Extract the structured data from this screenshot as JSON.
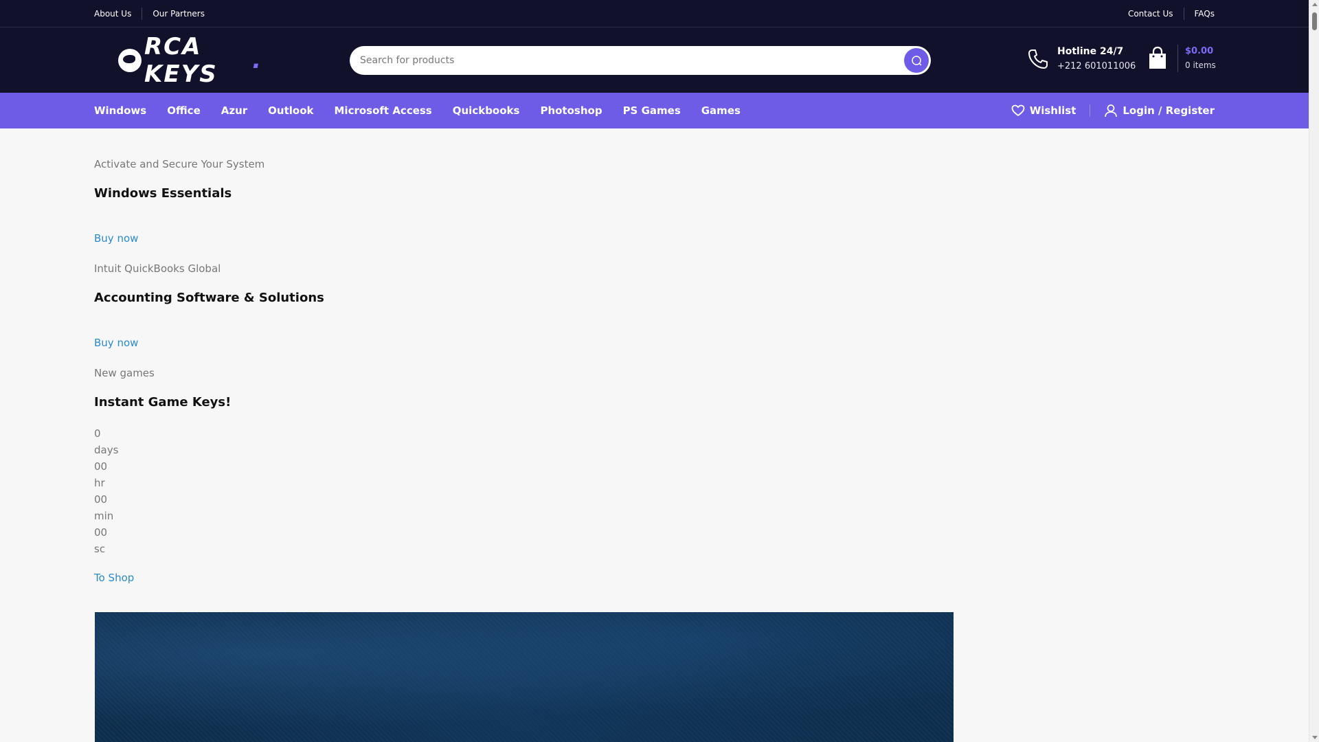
{
  "topbar": {
    "left_links": [
      "About Us",
      "Our Partners"
    ],
    "right_links": [
      "Contact Us",
      "FAQs"
    ]
  },
  "header": {
    "logo_text": "RCA KEYS",
    "logo_dot": ".",
    "search_placeholder": "Search for products",
    "hotline_title": "Hotline 24/7",
    "hotline_phone": "+212 601011006",
    "cart_price": "$0.00",
    "cart_items": "0 items"
  },
  "nav": {
    "items": [
      "Windows",
      "Office",
      "Azur",
      "Outlook",
      "Microsoft Access",
      "Quickbooks",
      "Photoshop",
      "PS Games",
      "Games"
    ],
    "wishlist": "Wishlist",
    "login": "Login / Register"
  },
  "slides": [
    {
      "eyebrow": "Activate and Secure Your System",
      "heading": "Windows Essentials",
      "link": "Buy now"
    },
    {
      "eyebrow": "Intuit QuickBooks Global",
      "heading": "Accounting Software & Solutions",
      "link": "Buy now"
    },
    {
      "eyebrow": "New games",
      "heading": "Instant Game Keys!",
      "link": "To Shop"
    }
  ],
  "countdown": [
    {
      "value": "0",
      "unit": "days"
    },
    {
      "value": "00",
      "unit": "hr"
    },
    {
      "value": "00",
      "unit": "min"
    },
    {
      "value": "00",
      "unit": "sc"
    }
  ],
  "colors": {
    "dark": "#12112b",
    "accent": "#6e5ce6",
    "link": "#2b8ac9"
  }
}
